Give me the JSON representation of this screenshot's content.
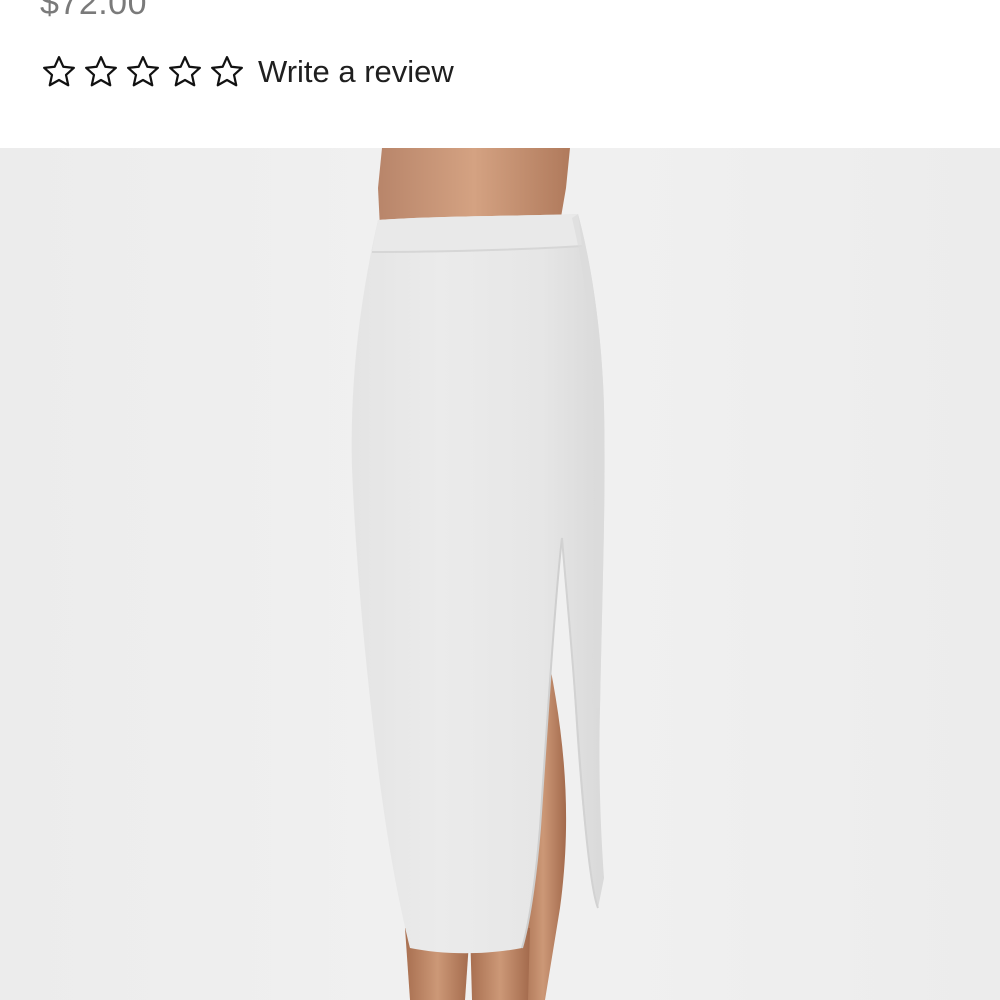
{
  "product": {
    "price": "$72.00",
    "rating": {
      "value": 0,
      "max": 5,
      "write_review_label": "Write a review"
    },
    "image": {
      "subject": "light grey midi skirt with side slit"
    }
  },
  "colors": {
    "background": "#ffffff",
    "price_text": "#7a7a7a",
    "review_text": "#1f1f1f",
    "image_background": "#eeeeee",
    "skirt": "#e7e7e7",
    "skin": "#c69574"
  }
}
